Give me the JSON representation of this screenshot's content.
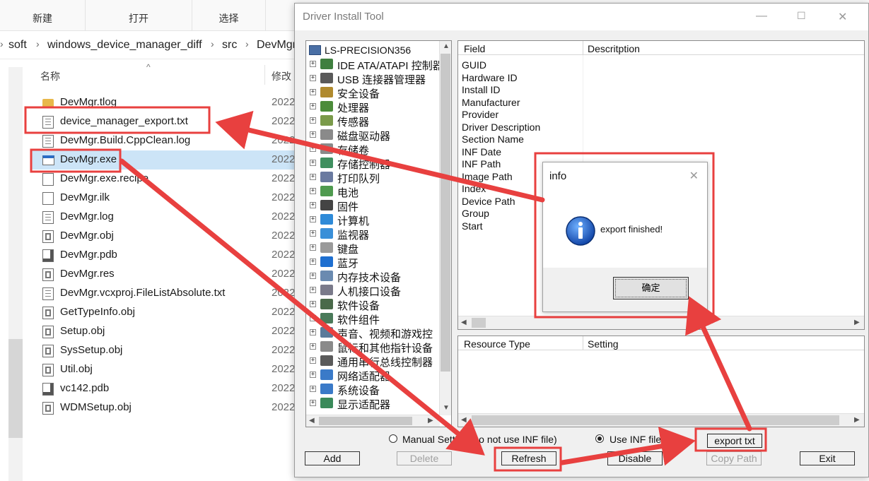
{
  "explorer": {
    "ribbon": {
      "tiny_label": "",
      "groups": [
        "新建",
        "打开",
        "选择"
      ]
    },
    "breadcrumb": [
      "soft",
      "windows_device_manager_diff",
      "src",
      "DevMgr"
    ],
    "columns": {
      "name": "名称",
      "modified": "修改"
    },
    "files": [
      {
        "name": "DevMgr.tlog",
        "date": "2022",
        "icon": "folder-icon"
      },
      {
        "name": "device_manager_export.txt",
        "date": "2022",
        "icon": "text-file-icon"
      },
      {
        "name": "DevMgr.Build.CppClean.log",
        "date": "2022",
        "icon": "text-file-icon"
      },
      {
        "name": "DevMgr.exe",
        "date": "2022",
        "icon": "exe-file-icon"
      },
      {
        "name": "DevMgr.exe.recipe",
        "date": "2022",
        "icon": "blank-file-icon"
      },
      {
        "name": "DevMgr.ilk",
        "date": "2022",
        "icon": "blank-file-icon"
      },
      {
        "name": "DevMgr.log",
        "date": "2022",
        "icon": "text-file-icon"
      },
      {
        "name": "DevMgr.obj",
        "date": "2022",
        "icon": "obj-file-icon"
      },
      {
        "name": "DevMgr.pdb",
        "date": "2022",
        "icon": "pdb-file-icon"
      },
      {
        "name": "DevMgr.res",
        "date": "2022",
        "icon": "res-file-icon"
      },
      {
        "name": "DevMgr.vcxproj.FileListAbsolute.txt",
        "date": "2022",
        "icon": "text-file-icon"
      },
      {
        "name": "GetTypeInfo.obj",
        "date": "2022",
        "icon": "obj-file-icon"
      },
      {
        "name": "Setup.obj",
        "date": "2022",
        "icon": "obj-file-icon"
      },
      {
        "name": "SysSetup.obj",
        "date": "2022",
        "icon": "obj-file-icon"
      },
      {
        "name": "Util.obj",
        "date": "2022",
        "icon": "obj-file-icon"
      },
      {
        "name": "vc142.pdb",
        "date": "2022",
        "icon": "pdb-file-icon"
      },
      {
        "name": "WDMSetup.obj",
        "date": "2022",
        "icon": "obj-file-icon"
      }
    ]
  },
  "tool": {
    "title": "Driver Install Tool",
    "tree": {
      "root": "LS-PRECISION356",
      "items": [
        {
          "label": "IDE ATA/ATAPI 控制器",
          "color": "#3f7f3f"
        },
        {
          "label": "USB 连接器管理器",
          "color": "#5a5a5a"
        },
        {
          "label": "安全设备",
          "color": "#b08a2e"
        },
        {
          "label": "处理器",
          "color": "#4c8c3a"
        },
        {
          "label": "传感器",
          "color": "#7a9a4a"
        },
        {
          "label": "磁盘驱动器",
          "color": "#8a8a8a"
        },
        {
          "label": "存储卷",
          "color": "#8a8a8a"
        },
        {
          "label": "存储控制器",
          "color": "#3f8f5f"
        },
        {
          "label": "打印队列",
          "color": "#6a7aa0"
        },
        {
          "label": "电池",
          "color": "#4f9a4f"
        },
        {
          "label": "固件",
          "color": "#444444"
        },
        {
          "label": "计算机",
          "color": "#2e8ad8"
        },
        {
          "label": "监视器",
          "color": "#3a8fd8"
        },
        {
          "label": "键盘",
          "color": "#9a9a9a"
        },
        {
          "label": "蓝牙",
          "color": "#1e6fd0"
        },
        {
          "label": "内存技术设备",
          "color": "#6a8ab0"
        },
        {
          "label": "人机接口设备",
          "color": "#7a7a8a"
        },
        {
          "label": "软件设备",
          "color": "#4a6a4a"
        },
        {
          "label": "软件组件",
          "color": "#4a7a5a"
        },
        {
          "label": "声音、视频和游戏控",
          "color": "#5a7a9a"
        },
        {
          "label": "鼠标和其他指针设备",
          "color": "#8a8a8a"
        },
        {
          "label": "通用串行总线控制器",
          "color": "#5a5a5a"
        },
        {
          "label": "网络适配器",
          "color": "#3a7ac8"
        },
        {
          "label": "系统设备",
          "color": "#3a7ac8"
        },
        {
          "label": "显示适配器",
          "color": "#3a8a5a"
        }
      ]
    },
    "details": {
      "columns": [
        "Field",
        "Descritption"
      ],
      "fields": [
        "GUID",
        "Hardware ID",
        "Install ID",
        "Manufacturer",
        "Provider",
        "Driver Description",
        "Section Name",
        "INF Date",
        "INF Path",
        "Image Path",
        "Index",
        "Device Path",
        "Group",
        "Start"
      ]
    },
    "resources": {
      "columns": [
        "Resource Type",
        "Setting"
      ]
    },
    "options": {
      "manual": "Manual Setting(Do not use INF file)",
      "inf": "Use INF file"
    },
    "buttons": {
      "export": "export txt",
      "add": "Add",
      "delete": "Delete",
      "refresh": "Refresh",
      "disable": "Disable",
      "copy_path": "Copy Path",
      "exit": "Exit"
    }
  },
  "dialog": {
    "title": "info",
    "message": "export finished!",
    "ok": "确定"
  },
  "colors": {
    "annotation": "#e8403f",
    "selection": "#cce4f7"
  }
}
